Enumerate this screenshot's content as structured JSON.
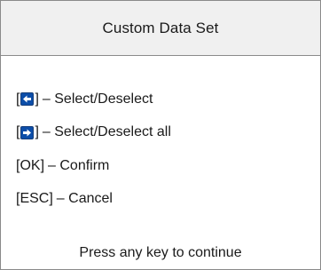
{
  "dialog": {
    "title": "Custom Data Set",
    "items": [
      {
        "open": "[",
        "key_icon": "left-arrow-key-icon",
        "close": "]",
        "description": "– Select/Deselect"
      },
      {
        "open": "[",
        "key_icon": "right-arrow-key-icon",
        "close": "]",
        "description": "– Select/Deselect all"
      },
      {
        "key_text": "[OK]",
        "description": "– Confirm"
      },
      {
        "key_text": "[ESC]",
        "description": "– Cancel"
      }
    ],
    "footer": "Press any key to continue"
  },
  "colors": {
    "title_bar_bg": "#f0f0f0",
    "key_icon_bg": "#0c4ea9",
    "border": "#8a8a8a"
  }
}
